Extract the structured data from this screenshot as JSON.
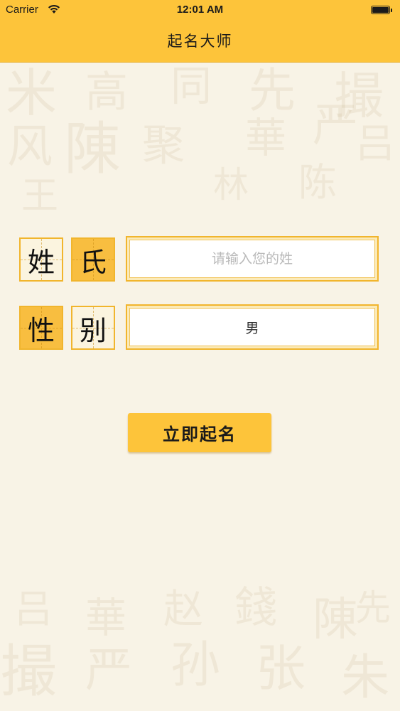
{
  "status_bar": {
    "carrier": "Carrier",
    "time": "12:01 AM"
  },
  "nav": {
    "title": "起名大师"
  },
  "form": {
    "surname_label": [
      "姓",
      "氏"
    ],
    "surname_input": {
      "placeholder": "请输入您的姓",
      "value": ""
    },
    "gender_label": [
      "性",
      "别"
    ],
    "gender_value": "男",
    "submit_label": "立即起名"
  },
  "colors": {
    "accent": "#fdc43a",
    "background": "#f8f3e6",
    "box_border": "#f1b52d"
  },
  "icons": [
    "wifi-icon",
    "battery-icon"
  ]
}
